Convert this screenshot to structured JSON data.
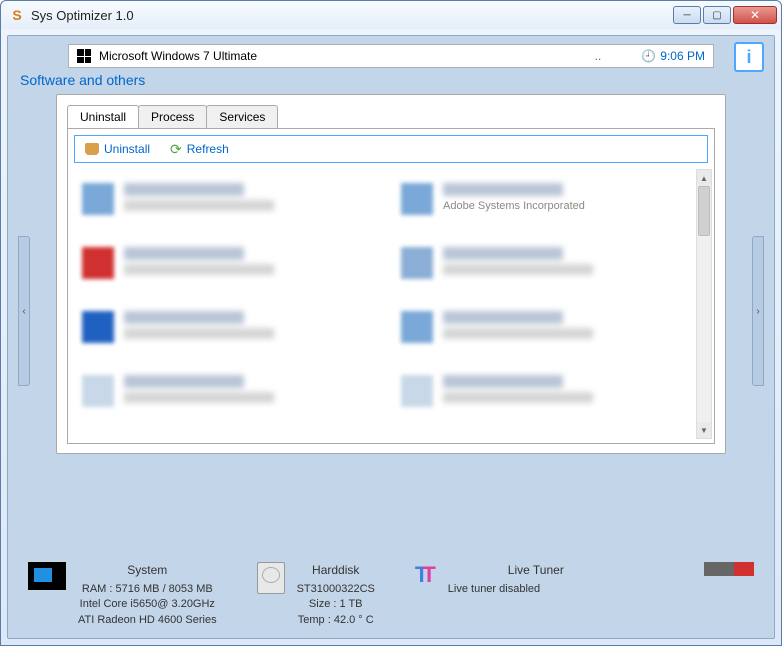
{
  "window": {
    "title": "Sys Optimizer 1.0"
  },
  "header": {
    "os": "Microsoft Windows 7 Ultimate",
    "dots": "..",
    "time": "9:06 PM"
  },
  "section": {
    "title": "Software and others"
  },
  "tabs": {
    "uninstall": "Uninstall",
    "process": "Process",
    "services": "Services"
  },
  "toolbar": {
    "uninstall": "Uninstall",
    "refresh": "Refresh"
  },
  "apps": {
    "publisher_visible": "Adobe Systems Incorporated"
  },
  "status": {
    "system": {
      "heading": "System",
      "ram": "RAM : 5716 MB / 8053 MB",
      "cpu": "Intel Core i5650@ 3.20GHz",
      "gpu": "ATI Radeon HD 4600 Series"
    },
    "harddisk": {
      "heading": "Harddisk",
      "model": "ST31000322CS",
      "size": "Size : 1 TB",
      "temp": "Temp : 42.0 ° C"
    },
    "tuner": {
      "heading": "Live Tuner",
      "status": "Live tuner disabled"
    }
  }
}
